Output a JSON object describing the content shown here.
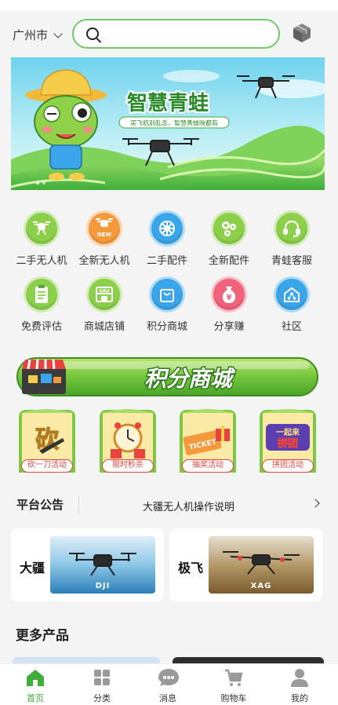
{
  "location": {
    "city": "广州市"
  },
  "search": {
    "placeholder": ""
  },
  "banner": {
    "title": "智慧青蛙",
    "subtitle": "买飞机别乱走，智慧青蛙啥都有"
  },
  "categories": [
    {
      "label": "二手无人机",
      "color": "#8ccf4a",
      "icon": "drone-icon"
    },
    {
      "label": "全新无人机",
      "color": "#f59a3c",
      "icon": "new-drone-icon",
      "badge": "NEW"
    },
    {
      "label": "二手配件",
      "color": "#3aa5e8",
      "icon": "gear-wheel-icon"
    },
    {
      "label": "全新配件",
      "color": "#8ccf4a",
      "icon": "flower-gear-icon"
    },
    {
      "label": "青蛙客服",
      "color": "#8ccf4a",
      "icon": "headset-icon"
    },
    {
      "label": "免费评估",
      "color": "#8ccf4a",
      "icon": "clipboard-icon"
    },
    {
      "label": "商城店铺",
      "color": "#8ccf4a",
      "icon": "uav-store-icon",
      "badge": "UAV"
    },
    {
      "label": "积分商城",
      "color": "#3aa5e8",
      "icon": "shopping-bag-icon"
    },
    {
      "label": "分享赚",
      "color": "#f0637a",
      "icon": "money-bag-icon"
    },
    {
      "label": "社区",
      "color": "#3aa5e8",
      "icon": "community-icon"
    }
  ],
  "points_mall_banner": {
    "title": "积分商城"
  },
  "activities": [
    {
      "label": "砍一刀活动",
      "art": "砍",
      "icon": "bargain-icon"
    },
    {
      "label": "限时秒杀",
      "icon": "alarm-clock-icon"
    },
    {
      "label": "抽奖活动",
      "art": "TICKET",
      "icon": "ticket-icon"
    },
    {
      "label": "拼团活动",
      "art_top": "一起来",
      "art_bottom": "拼团",
      "icon": "group-buy-icon"
    }
  ],
  "notice": {
    "title": "平台公告",
    "text": "大疆无人机操作说明"
  },
  "brands": [
    {
      "name": "大疆",
      "tag": "DJI"
    },
    {
      "name": "极飞",
      "tag": "XAG"
    }
  ],
  "more_products": {
    "title": "更多产品"
  },
  "tabbar": [
    {
      "label": "首页",
      "icon": "home-icon",
      "active": true
    },
    {
      "label": "分类",
      "icon": "category-grid-icon"
    },
    {
      "label": "消息",
      "icon": "message-icon"
    },
    {
      "label": "购物车",
      "icon": "cart-icon"
    },
    {
      "label": "我的",
      "icon": "profile-icon"
    }
  ],
  "colors": {
    "accent": "#3fae3a",
    "search_border": "#72c96a",
    "activity_red": "#e8433f"
  }
}
